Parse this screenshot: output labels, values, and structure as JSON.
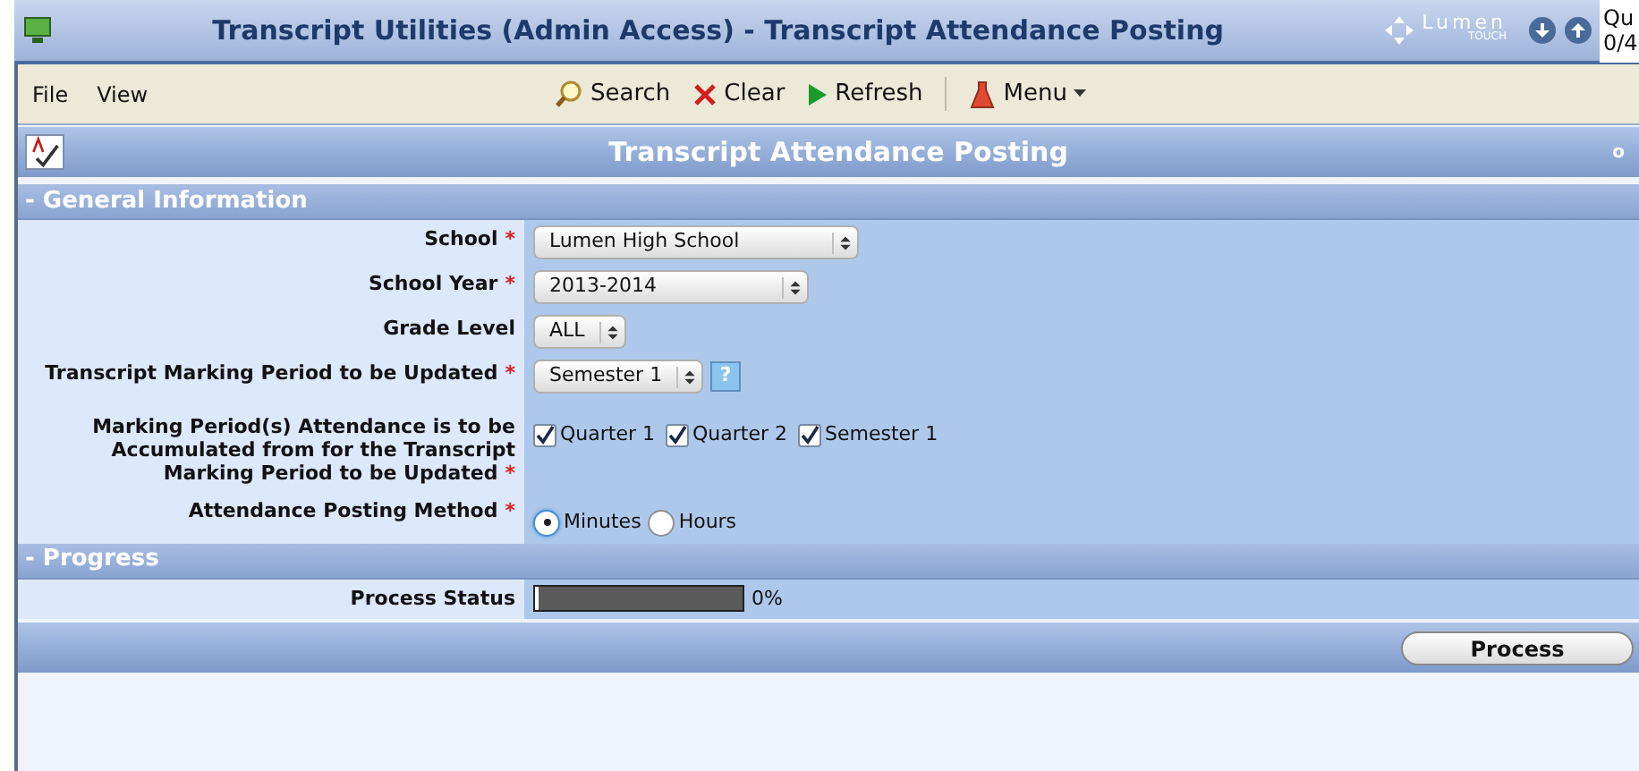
{
  "window": {
    "title": "Transcript Utilities (Admin Access) - Transcript Attendance Posting",
    "brand": "Lumen",
    "brand_sub": "TOUCH",
    "side_text": [
      "Qu",
      "0/4"
    ]
  },
  "menu": [
    "File",
    "View"
  ],
  "toolbar": [
    {
      "kind": "search",
      "label": "Search"
    },
    {
      "kind": "clear",
      "label": "Clear"
    },
    {
      "kind": "refresh",
      "label": "Refresh"
    },
    {
      "kind": "menu",
      "label": "Menu"
    }
  ],
  "page_header": {
    "title": "Transcript Attendance Posting",
    "corner": "o"
  },
  "sections": [
    {
      "title": "- General Information",
      "fields": [
        {
          "kind": "select",
          "label": "School",
          "required_mark": "*",
          "value": "Lumen High School"
        },
        {
          "kind": "select",
          "label": "School Year",
          "required_mark": "*",
          "value": "2013-2014"
        },
        {
          "kind": "select",
          "label": "Grade Level",
          "value": "ALL"
        },
        {
          "kind": "select_help",
          "label": "Transcript Marking Period to be Updated",
          "required_mark": "*",
          "value": "Semester 1",
          "help": "?"
        },
        {
          "kind": "checks",
          "label": "Marking Period(s) Attendance is to be Accumulated from for the Transcript Marking Period to be Updated",
          "required_mark": "*",
          "options": [
            {
              "label": "Quarter 1",
              "checked": true
            },
            {
              "label": "Quarter 2",
              "checked": true
            },
            {
              "label": "Semester 1",
              "checked": true
            }
          ]
        },
        {
          "kind": "radios",
          "label": "Attendance Posting Method",
          "required_mark": "*",
          "options": [
            {
              "label": "Minutes",
              "selected": true
            },
            {
              "label": "Hours",
              "selected": false
            }
          ]
        }
      ]
    },
    {
      "title": "- Progress",
      "fields": [
        {
          "kind": "progress",
          "label": "Process Status",
          "level": 0,
          "reading": "0%"
        }
      ]
    }
  ],
  "footer": {
    "button": "Process"
  }
}
